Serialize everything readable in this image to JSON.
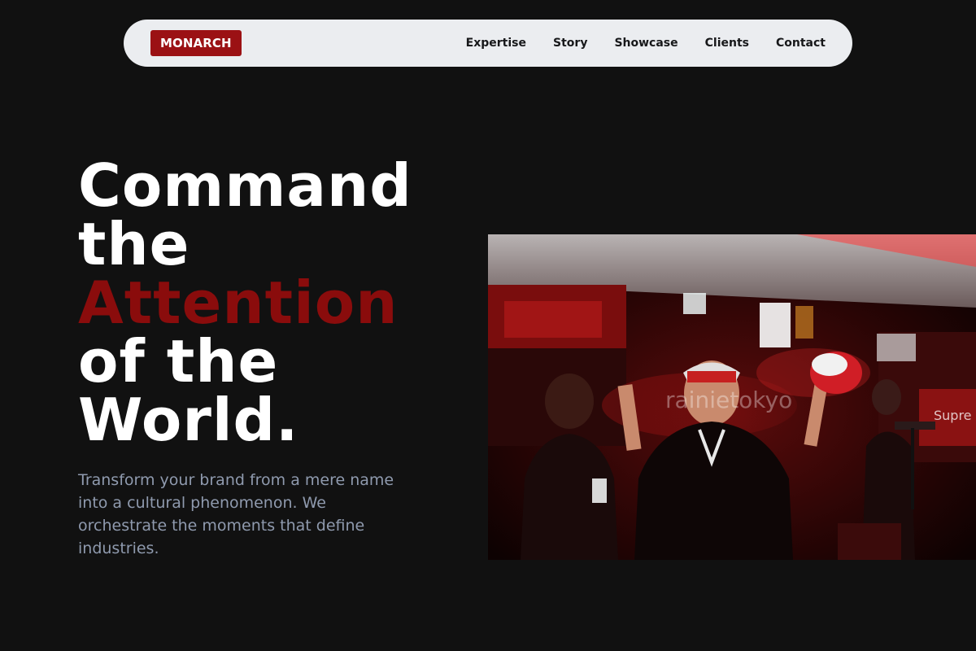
{
  "header": {
    "logo": "MONARCH",
    "nav": [
      {
        "label": "Expertise"
      },
      {
        "label": "Story"
      },
      {
        "label": "Showcase"
      },
      {
        "label": "Clients"
      },
      {
        "label": "Contact"
      }
    ]
  },
  "hero": {
    "title_lines": [
      "Command",
      "the",
      "Attention",
      "of the",
      "World."
    ],
    "subtitle": "Transform your brand from a mere name into a cultural phenomenon. We orchestrate the moments that define industries.",
    "photo": {
      "description_icon": "event-photo",
      "watermark": "rainietokyo",
      "signage": "Supre"
    }
  },
  "colors": {
    "background": "#111111",
    "accent": "#8a0c0c",
    "logo_bg": "#9b1114",
    "nav_bg": "#ebedf0",
    "subtitle": "#8f9aae"
  }
}
